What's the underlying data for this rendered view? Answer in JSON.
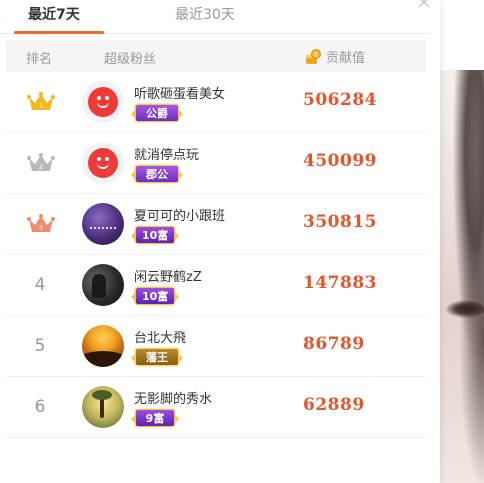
{
  "tabs": [
    {
      "label": "最近7天",
      "active": true
    },
    {
      "label": "最近30天",
      "active": false
    }
  ],
  "header": {
    "rank_label": "排名",
    "fans_label": "超级粉丝",
    "contrib_label": "贡献值"
  },
  "rows": [
    {
      "rank": "1",
      "rank_style": "crown-gold",
      "crown_number": "1",
      "avatar": "weibo-default-avatar",
      "name": "听歌砸蛋看美女",
      "badge": "公爵",
      "badge_style": "gong",
      "value": "506284"
    },
    {
      "rank": "2",
      "rank_style": "crown-silver",
      "crown_number": "2",
      "avatar": "weibo-default-avatar",
      "name": "就消停点玩",
      "badge": "郡公",
      "badge_style": "gong",
      "value": "450099"
    },
    {
      "rank": "3",
      "rank_style": "crown-bronze",
      "crown_number": "3",
      "avatar": "purple-photo-avatar",
      "name": "夏可可的小跟班",
      "badge": "10富",
      "badge_style": "fu",
      "value": "350815"
    },
    {
      "rank": "4",
      "rank_style": "number",
      "avatar": "dark-photo-avatar",
      "name": "闲云野鹤zZ",
      "badge": "10富",
      "badge_style": "fu",
      "value": "147883"
    },
    {
      "rank": "5",
      "rank_style": "number",
      "avatar": "sunset-photo-avatar",
      "name": "台北大飛",
      "badge": "藩王",
      "badge_style": "wang",
      "value": "86789"
    },
    {
      "rank": "6",
      "rank_style": "number",
      "avatar": "landscape-photo-avatar",
      "name": "无影脚的秀水",
      "badge": "9富",
      "badge_style": "fu",
      "value": "62889"
    }
  ],
  "colors": {
    "accent": "#f26b2a",
    "value_text": "#e8542a",
    "crown_gold": "#f5b81a",
    "crown_silver": "#b9b9b9",
    "crown_bronze": "#ee8b72"
  }
}
